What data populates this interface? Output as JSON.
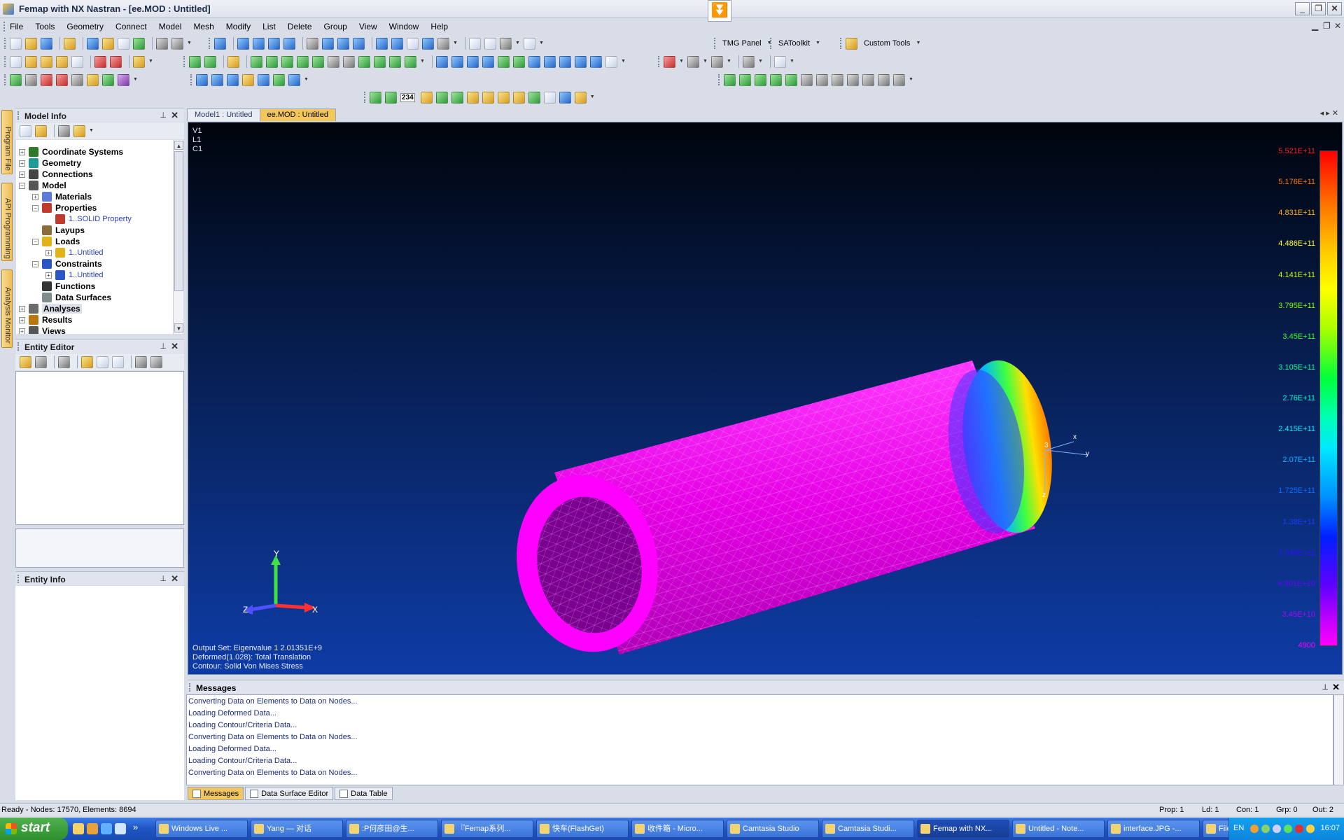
{
  "window": {
    "title": "Femap with NX Nastran - [ee.MOD : Untitled]",
    "center_button_glyph": "⏬",
    "controls": {
      "minimize": "_",
      "restore": "❐",
      "close": "✕"
    },
    "mdi_controls": {
      "minimize": "▁",
      "restore": "❐",
      "close": "✕"
    }
  },
  "menu": [
    "File",
    "Tools",
    "Geometry",
    "Connect",
    "Model",
    "Mesh",
    "Modify",
    "List",
    "Delete",
    "Group",
    "View",
    "Window",
    "Help"
  ],
  "toolbars": {
    "tmg_panel": "TMG Panel",
    "satoolkit": "SAToolkit",
    "custom_tools": "Custom Tools",
    "number_icon": "234"
  },
  "side_tabs": [
    "Program File",
    "API Programming",
    "Analysis Monitor"
  ],
  "model_info": {
    "title": "Model Info",
    "pin": "⊥",
    "close": "✕",
    "tree": [
      {
        "label": "Coordinate Systems",
        "level": 0,
        "expander": "+",
        "icon": "coordinate-systems-icon",
        "color": "#2d7a2d"
      },
      {
        "label": "Geometry",
        "level": 0,
        "expander": "+",
        "icon": "geometry-icon",
        "color": "#1e9a9a"
      },
      {
        "label": "Connections",
        "level": 0,
        "expander": "+",
        "icon": "connections-icon",
        "color": "#444444"
      },
      {
        "label": "Model",
        "level": 0,
        "expander": "−",
        "icon": "model-icon",
        "color": "#555555"
      },
      {
        "label": "Materials",
        "level": 1,
        "expander": "+",
        "icon": "materials-icon",
        "color": "#5b7bd6"
      },
      {
        "label": "Properties",
        "level": 1,
        "expander": "−",
        "icon": "properties-icon",
        "color": "#c0392b"
      },
      {
        "label": "1..SOLID Property",
        "level": 2,
        "expander": "",
        "icon": "solid-property-icon",
        "color": "#c0392b",
        "sub": true
      },
      {
        "label": "Layups",
        "level": 1,
        "expander": "",
        "icon": "layups-icon",
        "color": "#8a6d3b"
      },
      {
        "label": "Loads",
        "level": 1,
        "expander": "−",
        "icon": "loads-icon",
        "color": "#e2b318"
      },
      {
        "label": "1..Untitled",
        "level": 2,
        "expander": "+",
        "icon": "load-set-icon",
        "color": "#e2b318",
        "sub": true
      },
      {
        "label": "Constraints",
        "level": 1,
        "expander": "−",
        "icon": "constraints-icon",
        "color": "#2b56c6"
      },
      {
        "label": "1..Untitled",
        "level": 2,
        "expander": "+",
        "icon": "constraint-set-icon",
        "color": "#2b56c6",
        "sub": true
      },
      {
        "label": "Functions",
        "level": 1,
        "expander": "",
        "icon": "functions-icon",
        "color": "#333333"
      },
      {
        "label": "Data Surfaces",
        "level": 1,
        "expander": "",
        "icon": "data-surfaces-icon",
        "color": "#7f8c8d"
      },
      {
        "label": "Analyses",
        "level": 0,
        "expander": "+",
        "icon": "analyses-icon",
        "color": "#6b6b6b",
        "highlight": true
      },
      {
        "label": "Results",
        "level": 0,
        "expander": "+",
        "icon": "results-icon",
        "color": "#b9770e"
      },
      {
        "label": "Views",
        "level": 0,
        "expander": "+",
        "icon": "views-icon",
        "color": "#555555"
      }
    ]
  },
  "entity_editor": {
    "title": "Entity Editor",
    "pin": "⊥",
    "close": "✕"
  },
  "entity_info": {
    "title": "Entity Info",
    "pin": "⊥",
    "close": "✕"
  },
  "doc_tabs": [
    "Model1 : Untitled",
    "ee.MOD : Untitled"
  ],
  "doc_nav": "◂ ▸ ✕",
  "viewport": {
    "view_labels": [
      "V1",
      "L1",
      "C1"
    ],
    "axis_labels": {
      "y": "Y",
      "z": "Z",
      "x": "X"
    },
    "csys_labels": {
      "num": "3",
      "x": "x",
      "y": "y",
      "z": "z"
    },
    "caption": [
      "Output Set: Eigenvalue 1 2.01351E+9",
      "Deformed(1.028): Total Translation",
      "Contour: Solid Von Mises Stress"
    ],
    "legend": [
      {
        "value": "5.521E+11",
        "color": "#ff2020"
      },
      {
        "value": "5.176E+11",
        "color": "#ff7a00"
      },
      {
        "value": "4.831E+11",
        "color": "#ffb000"
      },
      {
        "value": "4.486E+11",
        "color": "#ffff30"
      },
      {
        "value": "4.141E+11",
        "color": "#c6ff00"
      },
      {
        "value": "3.795E+11",
        "color": "#7dff00"
      },
      {
        "value": "3.45E+11",
        "color": "#28ff28"
      },
      {
        "value": "3.105E+11",
        "color": "#00ff9c"
      },
      {
        "value": "2.76E+11",
        "color": "#00ffd6"
      },
      {
        "value": "2.415E+11",
        "color": "#00f0ff"
      },
      {
        "value": "2.07E+11",
        "color": "#00b4ff"
      },
      {
        "value": "1.725E+11",
        "color": "#0070ff"
      },
      {
        "value": "1.38E+11",
        "color": "#1c3cff"
      },
      {
        "value": "1.035E+11",
        "color": "#3010ff"
      },
      {
        "value": "6.901E+10",
        "color": "#6a00ff"
      },
      {
        "value": "3.45E+10",
        "color": "#b000ff"
      },
      {
        "value": "4900",
        "color": "#ff00ff"
      }
    ]
  },
  "messages": {
    "title": "Messages",
    "pin": "⊥",
    "close": "✕",
    "lines": [
      "Converting Data on Elements to Data on Nodes...",
      "Loading Deformed Data...",
      "Loading Contour/Criteria Data...",
      "Converting Data on Elements to Data on Nodes...",
      "Loading Deformed Data...",
      "Loading Contour/Criteria Data...",
      "Converting Data on Elements to Data on Nodes..."
    ],
    "tabs": [
      "Messages",
      "Data Surface Editor",
      "Data Table"
    ]
  },
  "status": {
    "left": "Ready - Nodes: 17570,  Elements: 8694",
    "prop": "Prop: 1",
    "ld": "Ld: 1",
    "con": "Con: 1",
    "grp": "Grp: 0",
    "out": "Out: 2"
  },
  "taskbar": {
    "start": "start",
    "tasks": [
      "Windows Live ...",
      "Yang — 对话",
      ":P何彦田@生...",
      "『Femap系列...",
      "快车(FlashGet)",
      "收件箱 - Micro...",
      "Camtasia Studio",
      "Camtasia Studi...",
      "Femap with NX...",
      "Untitled - Note...",
      "interface.JPG -...",
      "FileMenu.JPG -..."
    ],
    "active_index": 8,
    "quicklaunch_more": "»",
    "tray_lang": "EN",
    "clock": "16:07"
  }
}
